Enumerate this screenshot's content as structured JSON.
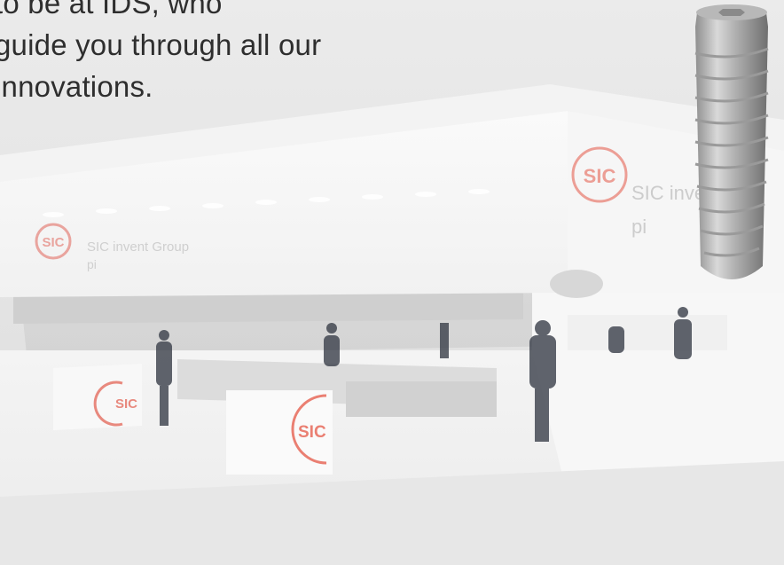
{
  "intro": {
    "line1": "to be at IDS, who",
    "line2": "guide you through all our",
    "line3": "innovations."
  },
  "booth": {
    "brand_logo_text": "SIC",
    "brand_name": "SIC invent Group",
    "sub_brand": "pi",
    "accent_color": "#d95b4f"
  }
}
